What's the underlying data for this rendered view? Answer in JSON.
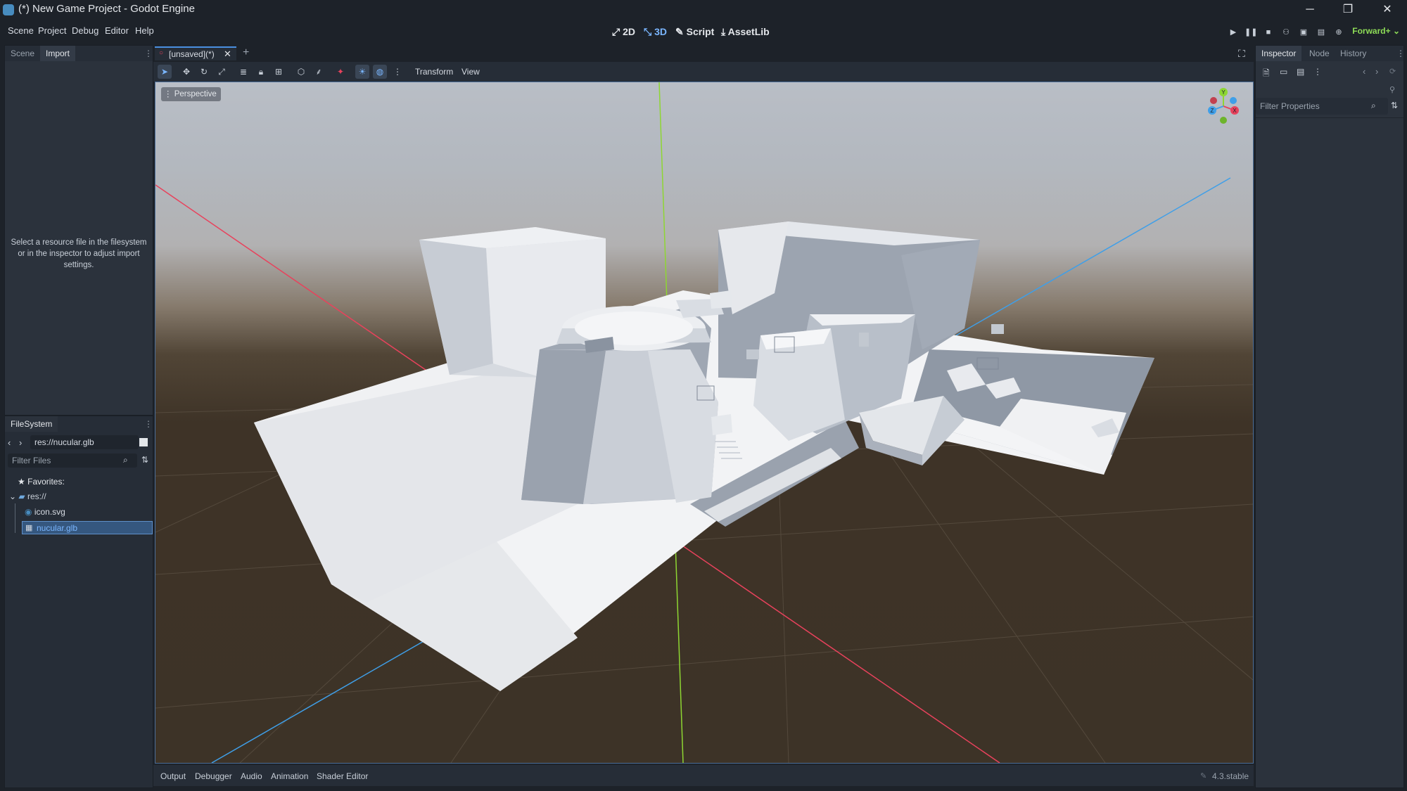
{
  "window": {
    "title": "(*) New Game Project - Godot Engine",
    "minimize": "─",
    "maximize": "❐",
    "close": "✕"
  },
  "menu": [
    "Scene",
    "Project",
    "Debug",
    "Editor",
    "Help"
  ],
  "workspaces": [
    {
      "label": "2D",
      "icon": "2d-icon"
    },
    {
      "label": "3D",
      "icon": "3d-icon",
      "active": true
    },
    {
      "label": "Script",
      "icon": "script-icon"
    },
    {
      "label": "AssetLib",
      "icon": "assetlib-icon"
    }
  ],
  "renderer": "Forward+",
  "left_dock": {
    "tabs": [
      "Scene",
      "Import"
    ],
    "active_tab": "Import",
    "import_message": "Select a resource file in the filesystem or in the inspector to adjust import settings."
  },
  "filesystem": {
    "title": "FileSystem",
    "path": "res://nucular.glb",
    "filter_placeholder": "Filter Files",
    "favorites_label": "Favorites:",
    "root_label": "res://",
    "files": [
      {
        "name": "icon.svg",
        "selected": false
      },
      {
        "name": "nucular.glb",
        "selected": true
      }
    ]
  },
  "viewport": {
    "scene_tab": "[unsaved](*)",
    "add_tab": "+",
    "toolbar_menus": [
      "Transform",
      "View"
    ],
    "perspective_label": "Perspective",
    "gizmo": {
      "x": "X",
      "y": "Y",
      "z": "Z"
    }
  },
  "bottom_panel": {
    "tabs": [
      "Output",
      "Debugger",
      "Audio",
      "Animation",
      "Shader Editor"
    ],
    "version": "4.3.stable"
  },
  "inspector": {
    "tabs": [
      "Inspector",
      "Node",
      "History"
    ],
    "active_tab": "Inspector",
    "filter_placeholder": "Filter Properties"
  },
  "colors": {
    "accent": "#4a8fe0",
    "x_axis": "#e8425c",
    "y_axis": "#8ed632",
    "z_axis": "#3f9fe8",
    "renderer": "#8edc57"
  }
}
